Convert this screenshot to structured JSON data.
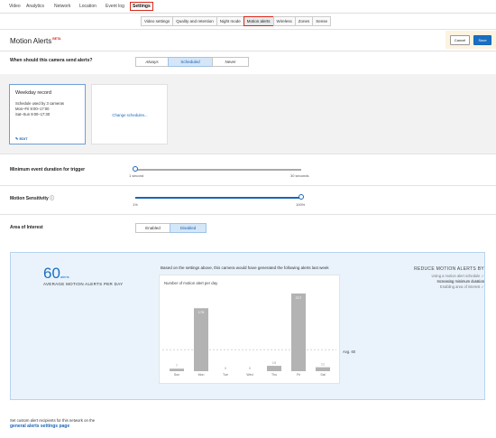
{
  "topnav": {
    "items": [
      "Video",
      "Analytics",
      "Network",
      "Location",
      "Event log",
      "Settings"
    ],
    "selected": "Settings"
  },
  "subnav": {
    "tabs": [
      "Video settings",
      "Quality and retention",
      "Night mode",
      "Motion alerts",
      "Wireless",
      "Zones",
      "Sense"
    ],
    "selected": "Motion alerts"
  },
  "page": {
    "title": "Motion Alerts",
    "beta": "BETA",
    "cancel_label": "Cancel",
    "save_label": "Save"
  },
  "send_alerts": {
    "label": "When should this camera send alerts?",
    "options": [
      "Always",
      "Scheduled",
      "Never"
    ],
    "selected": "Scheduled"
  },
  "schedule_card": {
    "title": "Weekday record",
    "used_by": "Schedule used by 3 cameras",
    "line1": "Mon–Fri 9:00–17:00",
    "line2": "Sat–Sun 9:00–17:30",
    "edit_label": "EDIT",
    "change_link": "Change schedules..."
  },
  "min_duration": {
    "label": "Minimum event duration for trigger",
    "min_label": "1 second",
    "max_label": "30 seconds",
    "value_fraction": 0.0
  },
  "sensitivity": {
    "label": "Motion Sensitivity",
    "info_icon": "info-icon",
    "min_label": "1%",
    "max_label": "100%",
    "value_fraction": 1.0
  },
  "area_of_interest": {
    "label": "Area of Interest",
    "options": [
      "Enabled",
      "Disabled"
    ],
    "selected": "Disabled"
  },
  "summary": {
    "count": "60",
    "count_unit": "alerts",
    "caption": "AVERAGE MOTION ALERTS PER DAY",
    "chart_heading": "Based on the settings above, this camera would have generated the following alerts last week",
    "reduce_heading": "REDUCE MOTION ALERTS BY",
    "reduce_items": [
      "Using a motion alert schedule ✓",
      "Increasing minimum duration",
      "Enabling area of interest ✓"
    ]
  },
  "chart_data": {
    "type": "bar",
    "ylabel": "Number of motion alert per day",
    "categories": [
      "Sun",
      "Mon",
      "Tue",
      "Wed",
      "Thu",
      "Fri",
      "Sat"
    ],
    "values": [
      7,
      176,
      0,
      0,
      15,
      217,
      11
    ],
    "value_labels": [
      "7",
      "176",
      "0",
      "0",
      "15",
      "217",
      "11"
    ],
    "average": 60,
    "average_label": "Avg. 60",
    "ylim": [
      0,
      240
    ],
    "bar_color": "#b3b3b3",
    "grid": false
  },
  "footer": {
    "text": "Set custom alert recipients for this network on the",
    "link": "general alerts settings page"
  },
  "colors": {
    "accent_blue": "#1a6fc1",
    "highlight_red": "#d9291c",
    "panel_bg": "#eaf3fc"
  }
}
